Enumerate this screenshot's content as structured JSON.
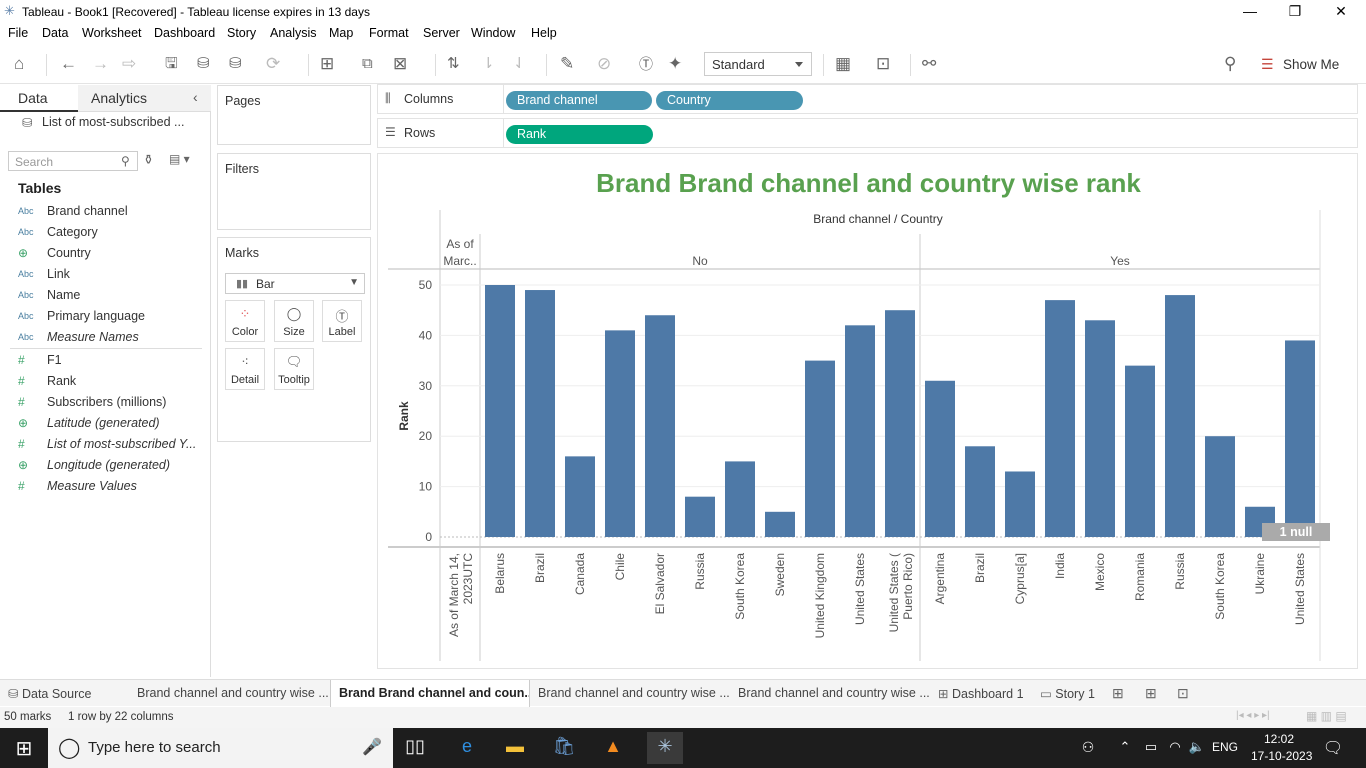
{
  "window": {
    "title": "Tableau - Book1 [Recovered] - Tableau license expires in 13 days"
  },
  "menu": [
    "File",
    "Data",
    "Worksheet",
    "Dashboard",
    "Story",
    "Analysis",
    "Map",
    "Format",
    "Server",
    "Window",
    "Help"
  ],
  "toolbar": {
    "view_mode": "Standard",
    "show_me": "Show Me"
  },
  "data_pane": {
    "tab_data": "Data",
    "tab_analytics": "Analytics",
    "datasource": "List of most-subscribed ...",
    "search_placeholder": "Search",
    "tables_header": "Tables",
    "dimensions": [
      {
        "type": "Abc",
        "name": "Brand channel"
      },
      {
        "type": "Abc",
        "name": "Category"
      },
      {
        "type": "globe",
        "name": "Country"
      },
      {
        "type": "Abc",
        "name": "Link"
      },
      {
        "type": "Abc",
        "name": "Name"
      },
      {
        "type": "Abc",
        "name": "Primary language"
      },
      {
        "type": "Abc",
        "name": "Measure Names"
      }
    ],
    "measures": [
      {
        "type": "#",
        "name": "F1"
      },
      {
        "type": "#",
        "name": "Rank"
      },
      {
        "type": "#",
        "name": "Subscribers (millions)"
      },
      {
        "type": "globe",
        "name": "Latitude (generated)"
      },
      {
        "type": "#",
        "name": "List of most-subscribed Y..."
      },
      {
        "type": "globe",
        "name": "Longitude (generated)"
      },
      {
        "type": "#",
        "name": "Measure Values"
      }
    ]
  },
  "cards": {
    "pages": "Pages",
    "filters": "Filters",
    "marks": "Marks",
    "mark_type": "Bar",
    "mark_buttons": [
      "Color",
      "Size",
      "Label",
      "Detail",
      "Tooltip"
    ]
  },
  "shelves": {
    "columns_label": "Columns",
    "rows_label": "Rows",
    "columns_pills": [
      "Brand channel",
      "Country"
    ],
    "rows_pills": [
      "Rank"
    ]
  },
  "sheet": {
    "title": "Brand Brand channel and country wise rank",
    "header": "Brand channel / Country",
    "null_indicator": "1 null"
  },
  "chart_data": {
    "type": "bar",
    "title": "Brand Brand channel and country wise rank",
    "ylabel": "Rank",
    "xlabel": "Brand channel / Country",
    "ylim": [
      0,
      55
    ],
    "yticks": [
      0,
      10,
      20,
      30,
      40,
      50
    ],
    "grid": true,
    "groups": [
      {
        "name": "As of Marc..",
        "categories": [
          "As of March 14, 2023UTC"
        ],
        "values": [
          null
        ]
      },
      {
        "name": "No",
        "categories": [
          "Belarus",
          "Brazil",
          "Canada",
          "Chile",
          "El Salvador",
          "Russia",
          "South Korea",
          "Sweden",
          "United Kingdom",
          "United States",
          "United States (Puerto Rico)"
        ],
        "values": [
          50,
          49,
          16,
          41,
          44,
          8,
          15,
          5,
          35,
          42,
          45
        ]
      },
      {
        "name": "Yes",
        "categories": [
          "Argentina",
          "Brazil",
          "Cyprus[a]",
          "India",
          "Mexico",
          "Romania",
          "Russia",
          "South Korea",
          "Ukraine",
          "United States"
        ],
        "values": [
          31,
          18,
          13,
          47,
          43,
          34,
          48,
          20,
          6,
          39
        ]
      }
    ],
    "bar_color": "#4e79a7"
  },
  "bottom_tabs": [
    {
      "label": "Data Source",
      "icon": "database-icon"
    },
    {
      "label": "Brand channel and country wise ..."
    },
    {
      "label": "Brand Brand channel and coun...",
      "active": true
    },
    {
      "label": "Brand channel and country wise ..."
    },
    {
      "label": "Brand channel and country wise ..."
    },
    {
      "label": "Dashboard 1",
      "icon": "dashboard-icon"
    },
    {
      "label": "Story 1",
      "icon": "story-icon"
    }
  ],
  "status": {
    "marks": "50 marks",
    "dims": "1 row by 22 columns"
  },
  "taskbar": {
    "search_placeholder": "Type here to search",
    "lang": "ENG",
    "time": "12:02",
    "date": "17-10-2023"
  }
}
